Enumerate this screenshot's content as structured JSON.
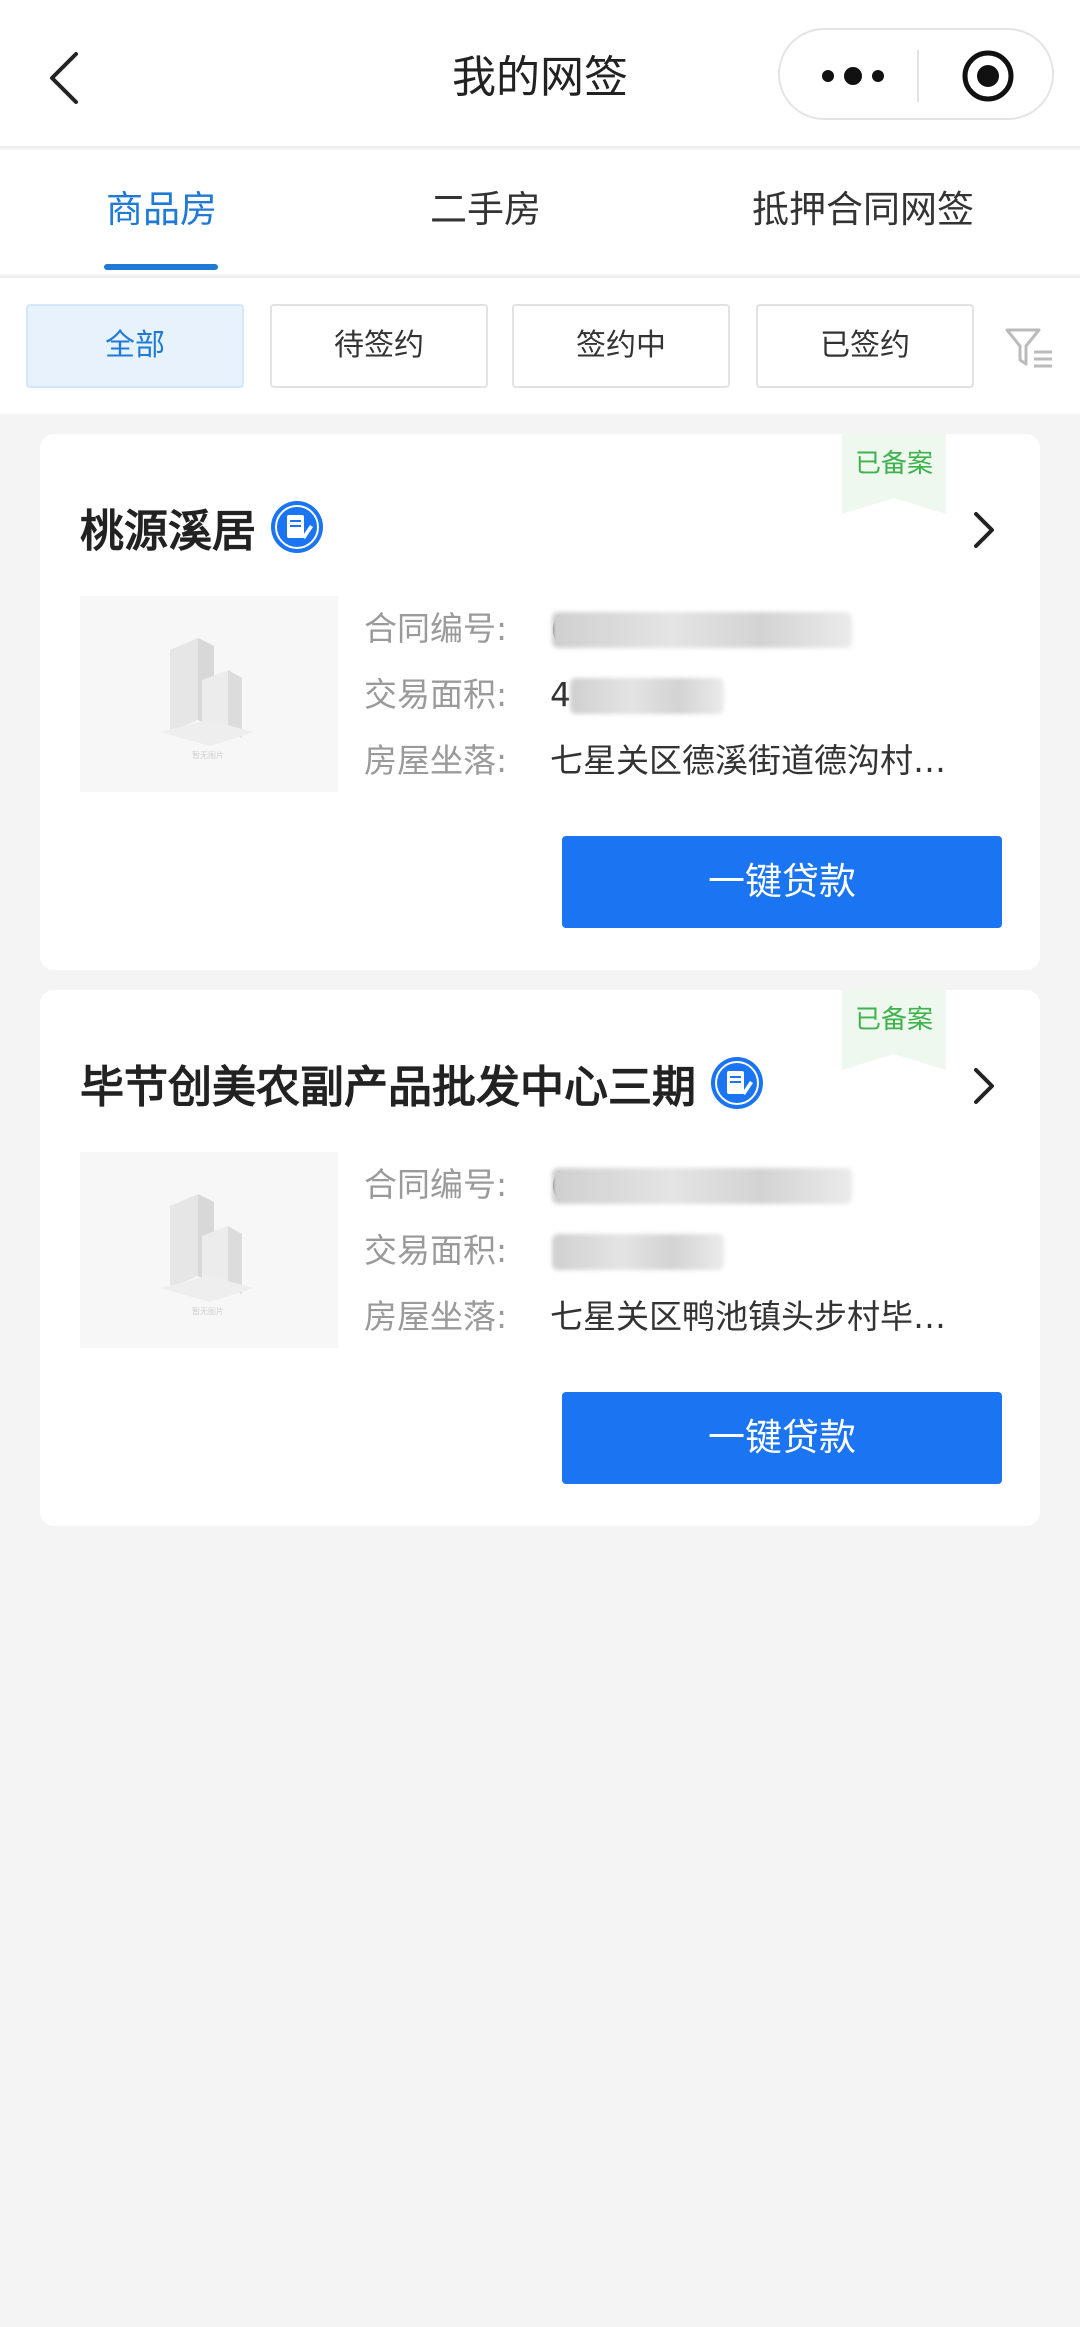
{
  "navbar": {
    "title": "我的网签"
  },
  "tabs": [
    {
      "label": "商品房",
      "active": true
    },
    {
      "label": "二手房",
      "active": false
    },
    {
      "label": "抵押合同网签",
      "active": false
    }
  ],
  "filters": [
    {
      "label": "全部",
      "active": true
    },
    {
      "label": "待签约",
      "active": false
    },
    {
      "label": "签约中",
      "active": false
    },
    {
      "label": "已签约",
      "active": false
    }
  ],
  "field_labels": {
    "contract_no": "合同编号:",
    "area": "交易面积:",
    "address": "房屋坐落:"
  },
  "cards": [
    {
      "title": "桃源溪居",
      "status": "已备案",
      "contract_no_visible": "(",
      "area_visible": "4",
      "address": "七星关区德溪街道德沟村…",
      "button_label": "一键贷款"
    },
    {
      "title": "毕节创美农副产品批发中心三期",
      "status": "已备案",
      "contract_no_visible": "(",
      "area_visible": "",
      "address": "七星关区鸭池镇头步村毕…",
      "button_label": "一键贷款"
    }
  ],
  "colors": {
    "accent": "#1f7ad6",
    "button": "#1b74f2",
    "status_green": "#3fb24d",
    "background": "#f4f4f5"
  }
}
